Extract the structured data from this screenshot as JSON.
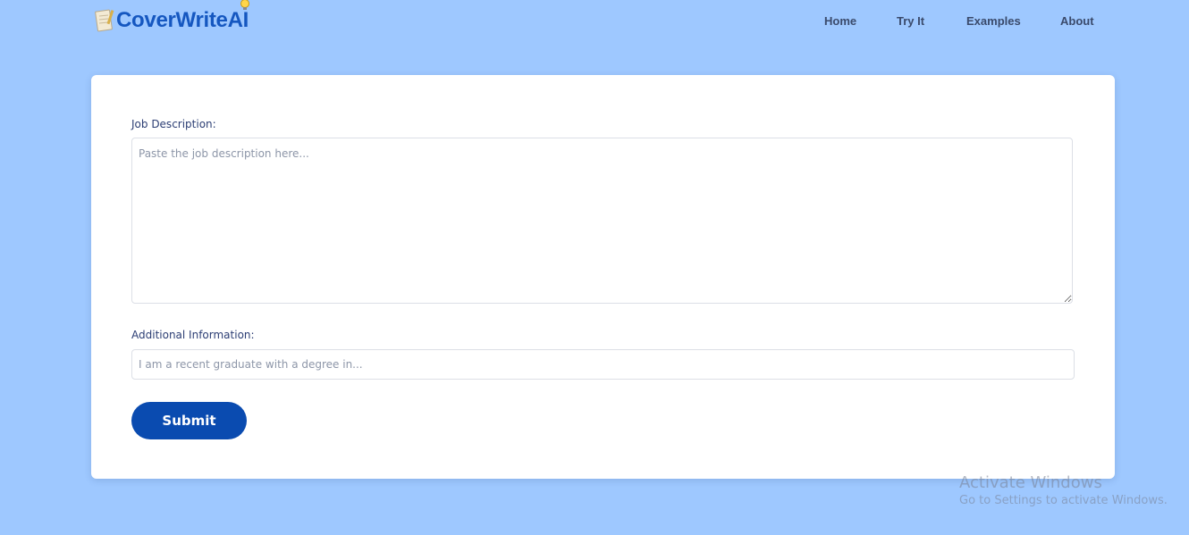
{
  "header": {
    "logo_text": "CoverWriteAI",
    "nav": [
      "Home",
      "Try It",
      "Examples",
      "About"
    ]
  },
  "form": {
    "job_label": "Job Description:",
    "job_placeholder": "Paste the job description here...",
    "info_label": "Additional Information:",
    "info_placeholder": "I am a recent graduate with a degree in...",
    "submit_label": "Submit"
  },
  "watermark": {
    "title": "Activate Windows",
    "subtitle": "Go to Settings to activate Windows."
  },
  "colors": {
    "background": "#9ec8ff",
    "brand": "#1557c0",
    "button": "#0a4bb0"
  },
  "icons": {
    "logo": "notebook-icon",
    "logo_accent": "lightbulb-icon"
  }
}
